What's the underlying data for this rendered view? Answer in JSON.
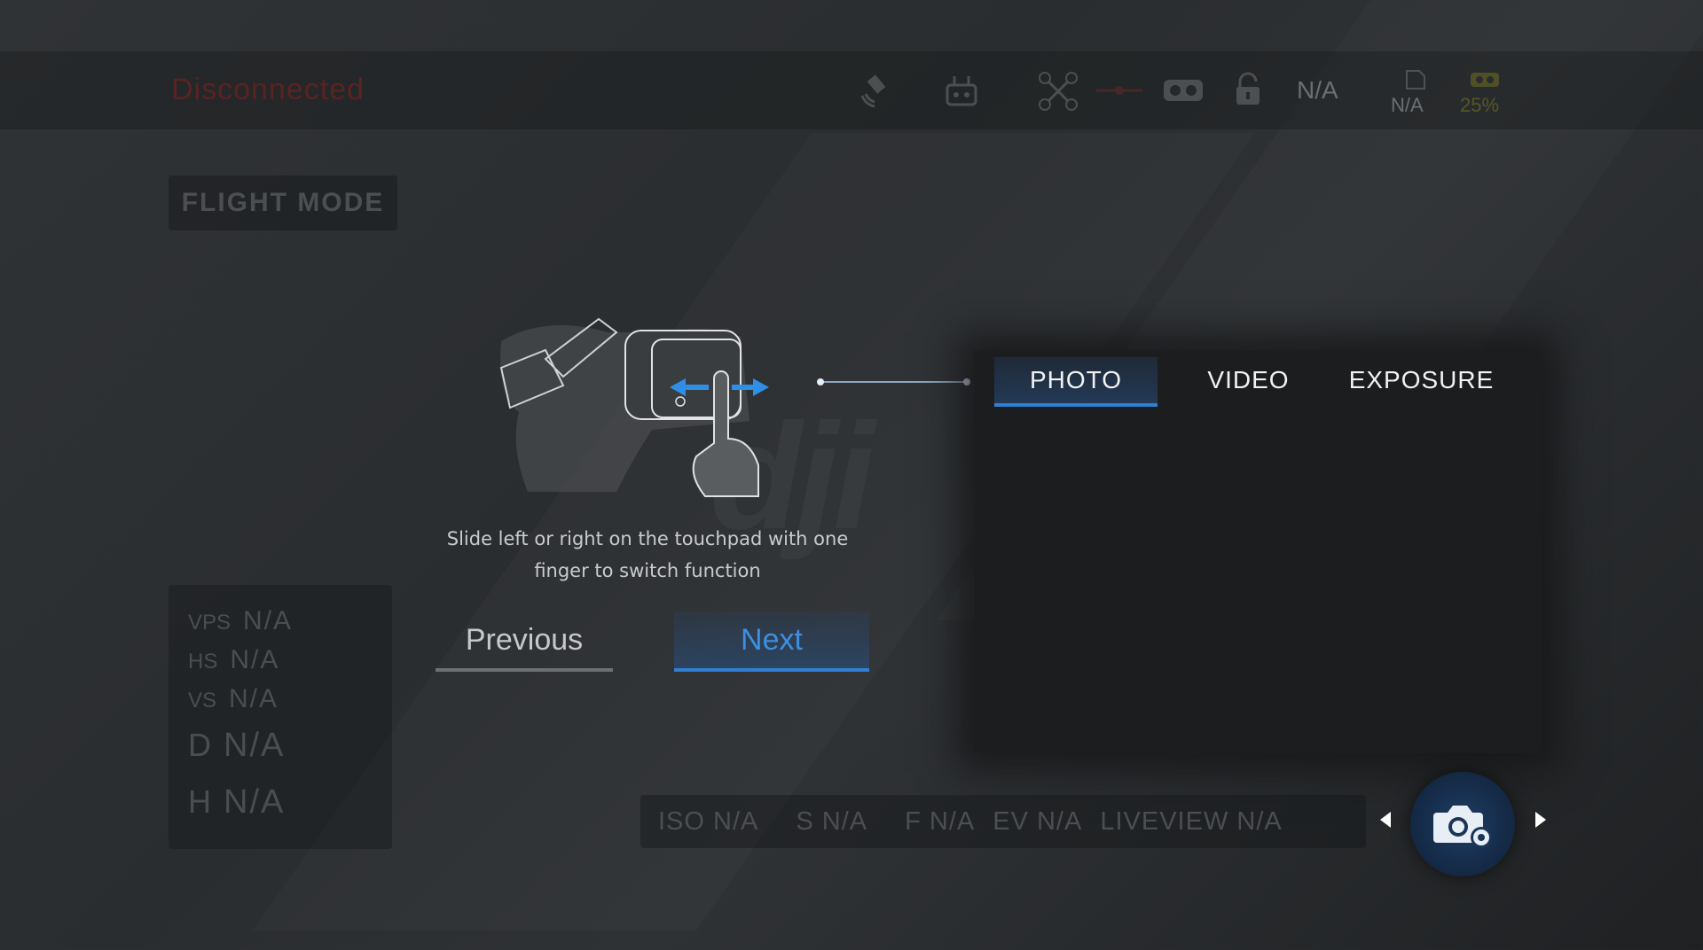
{
  "status": {
    "connection": "Disconnected",
    "color": "#5a2323"
  },
  "topbar": {
    "icons": [
      "satellite-icon",
      "remote-controller-icon",
      "drone-icon",
      "signal-icon",
      "goggles-icon",
      "lock-icon"
    ],
    "signal_value": "N/A",
    "sd_card_value": "N/A",
    "goggles_battery": "25%"
  },
  "flight_mode": {
    "label": "FLIGHT MODE"
  },
  "telemetry": {
    "rows": [
      {
        "key": "VPS",
        "value": "N/A"
      },
      {
        "key": "HS",
        "value": "N/A"
      },
      {
        "key": "VS",
        "value": "N/A"
      },
      {
        "key": "D",
        "value": "N/A"
      },
      {
        "key": "H",
        "value": "N/A"
      }
    ]
  },
  "guide": {
    "text_line1": "Slide left or right on the touchpad with one",
    "text_line2": "finger to switch function",
    "previous_label": "Previous",
    "next_label": "Next"
  },
  "tabs": [
    {
      "label": "PHOTO",
      "active": true
    },
    {
      "label": "VIDEO",
      "active": false
    },
    {
      "label": "EXPOSURE",
      "active": false
    }
  ],
  "camera_bar": {
    "iso": "ISO N/A",
    "shutter": "S N/A",
    "aperture": "F N/A",
    "ev": "EV N/A",
    "liveview": "LIVEVIEW N/A"
  },
  "colors": {
    "accent": "#2f7fd6",
    "next_text": "#3d8fe0",
    "goggles_battery": "#6b6a1f"
  },
  "watermark": "dji"
}
